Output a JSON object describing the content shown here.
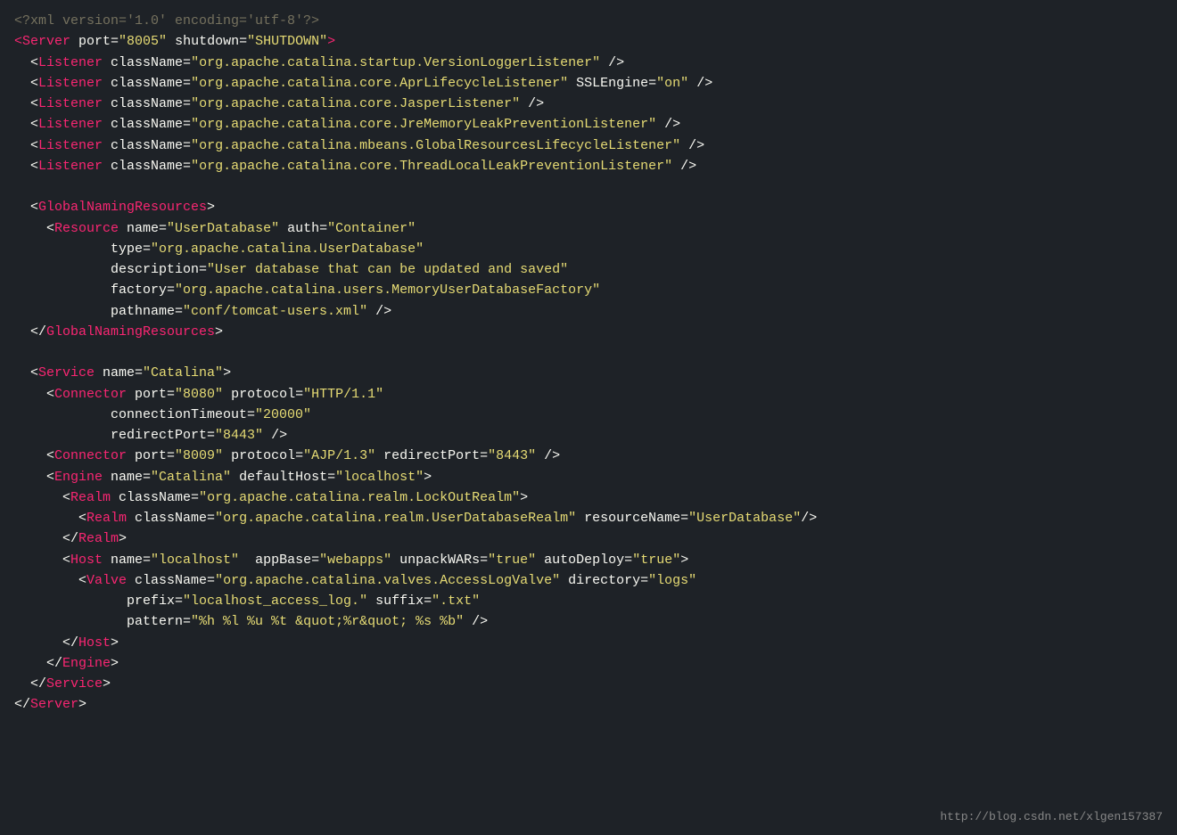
{
  "watermark": "http://blog.csdn.net/xlgen157387",
  "lines": [
    {
      "parts": [
        {
          "text": "<?xml version='1.0' encoding='utf-8'?>",
          "class": "prolog"
        }
      ]
    },
    {
      "parts": [
        {
          "text": "<",
          "class": "tag"
        },
        {
          "text": "Server",
          "class": "tag"
        },
        {
          "text": " port=",
          "class": "white"
        },
        {
          "text": "\"8005\"",
          "class": "attr-value"
        },
        {
          "text": " shutdown=",
          "class": "white"
        },
        {
          "text": "\"SHUTDOWN\"",
          "class": "attr-value"
        },
        {
          "text": ">",
          "class": "tag"
        }
      ]
    },
    {
      "parts": [
        {
          "text": "  <",
          "class": "white"
        },
        {
          "text": "Listener",
          "class": "tag"
        },
        {
          "text": " className=",
          "class": "white"
        },
        {
          "text": "\"org.apache.catalina.startup.VersionLoggerListener\"",
          "class": "attr-value"
        },
        {
          "text": " />",
          "class": "white"
        }
      ]
    },
    {
      "parts": [
        {
          "text": "  <",
          "class": "white"
        },
        {
          "text": "Listener",
          "class": "tag"
        },
        {
          "text": " className=",
          "class": "white"
        },
        {
          "text": "\"org.apache.catalina.core.AprLifecycleListener\"",
          "class": "attr-value"
        },
        {
          "text": " SSLEngine=",
          "class": "white"
        },
        {
          "text": "\"on\"",
          "class": "attr-value"
        },
        {
          "text": " />",
          "class": "white"
        }
      ]
    },
    {
      "parts": [
        {
          "text": "  <",
          "class": "white"
        },
        {
          "text": "Listener",
          "class": "tag"
        },
        {
          "text": " className=",
          "class": "white"
        },
        {
          "text": "\"org.apache.catalina.core.JasperListener\"",
          "class": "attr-value"
        },
        {
          "text": " />",
          "class": "white"
        }
      ]
    },
    {
      "parts": [
        {
          "text": "  <",
          "class": "white"
        },
        {
          "text": "Listener",
          "class": "tag"
        },
        {
          "text": " className=",
          "class": "white"
        },
        {
          "text": "\"org.apache.catalina.core.JreMemoryLeakPreventionListener\"",
          "class": "attr-value"
        },
        {
          "text": " />",
          "class": "white"
        }
      ]
    },
    {
      "parts": [
        {
          "text": "  <",
          "class": "white"
        },
        {
          "text": "Listener",
          "class": "tag"
        },
        {
          "text": " className=",
          "class": "white"
        },
        {
          "text": "\"org.apache.catalina.mbeans.GlobalResourcesLifecycleListener\"",
          "class": "attr-value"
        },
        {
          "text": " />",
          "class": "white"
        }
      ]
    },
    {
      "parts": [
        {
          "text": "  <",
          "class": "white"
        },
        {
          "text": "Listener",
          "class": "tag"
        },
        {
          "text": " className=",
          "class": "white"
        },
        {
          "text": "\"org.apache.catalina.core.ThreadLocalLeakPreventionListener\"",
          "class": "attr-value"
        },
        {
          "text": " />",
          "class": "white"
        }
      ]
    },
    {
      "parts": [
        {
          "text": "",
          "class": "white"
        }
      ]
    },
    {
      "parts": [
        {
          "text": "  <",
          "class": "white"
        },
        {
          "text": "GlobalNamingResources",
          "class": "tag"
        },
        {
          "text": ">",
          "class": "white"
        }
      ]
    },
    {
      "parts": [
        {
          "text": "    <",
          "class": "white"
        },
        {
          "text": "Resource",
          "class": "tag"
        },
        {
          "text": " name=",
          "class": "white"
        },
        {
          "text": "\"UserDatabase\"",
          "class": "attr-value"
        },
        {
          "text": " auth=",
          "class": "white"
        },
        {
          "text": "\"Container\"",
          "class": "attr-value"
        }
      ]
    },
    {
      "parts": [
        {
          "text": "            type=",
          "class": "white"
        },
        {
          "text": "\"org.apache.catalina.UserDatabase\"",
          "class": "attr-value"
        }
      ]
    },
    {
      "parts": [
        {
          "text": "            description=",
          "class": "white"
        },
        {
          "text": "\"User database that can be updated and saved\"",
          "class": "attr-value"
        }
      ]
    },
    {
      "parts": [
        {
          "text": "            factory=",
          "class": "white"
        },
        {
          "text": "\"org.apache.catalina.users.MemoryUserDatabaseFactory\"",
          "class": "attr-value"
        }
      ]
    },
    {
      "parts": [
        {
          "text": "            pathname=",
          "class": "white"
        },
        {
          "text": "\"conf/tomcat-users.xml\"",
          "class": "attr-value"
        },
        {
          "text": " />",
          "class": "white"
        }
      ]
    },
    {
      "parts": [
        {
          "text": "  </",
          "class": "white"
        },
        {
          "text": "GlobalNamingResources",
          "class": "tag"
        },
        {
          "text": ">",
          "class": "white"
        }
      ]
    },
    {
      "parts": [
        {
          "text": "",
          "class": "white"
        }
      ]
    },
    {
      "parts": [
        {
          "text": "  <",
          "class": "white"
        },
        {
          "text": "Service",
          "class": "tag"
        },
        {
          "text": " name=",
          "class": "white"
        },
        {
          "text": "\"Catalina\"",
          "class": "attr-value"
        },
        {
          "text": ">",
          "class": "white"
        }
      ]
    },
    {
      "parts": [
        {
          "text": "    <",
          "class": "white"
        },
        {
          "text": "Connector",
          "class": "tag"
        },
        {
          "text": " port=",
          "class": "white"
        },
        {
          "text": "\"8080\"",
          "class": "attr-value"
        },
        {
          "text": " protocol=",
          "class": "white"
        },
        {
          "text": "\"HTTP/1.1\"",
          "class": "attr-value"
        }
      ]
    },
    {
      "parts": [
        {
          "text": "            connectionTimeout=",
          "class": "white"
        },
        {
          "text": "\"20000\"",
          "class": "attr-value"
        }
      ]
    },
    {
      "parts": [
        {
          "text": "            redirectPort=",
          "class": "white"
        },
        {
          "text": "\"8443\"",
          "class": "attr-value"
        },
        {
          "text": " />",
          "class": "white"
        }
      ]
    },
    {
      "parts": [
        {
          "text": "    <",
          "class": "white"
        },
        {
          "text": "Connector",
          "class": "tag"
        },
        {
          "text": " port=",
          "class": "white"
        },
        {
          "text": "\"8009\"",
          "class": "attr-value"
        },
        {
          "text": " protocol=",
          "class": "white"
        },
        {
          "text": "\"AJP/1.3\"",
          "class": "attr-value"
        },
        {
          "text": " redirectPort=",
          "class": "white"
        },
        {
          "text": "\"8443\"",
          "class": "attr-value"
        },
        {
          "text": " />",
          "class": "white"
        }
      ]
    },
    {
      "parts": [
        {
          "text": "    <",
          "class": "white"
        },
        {
          "text": "Engine",
          "class": "tag"
        },
        {
          "text": " name=",
          "class": "white"
        },
        {
          "text": "\"Catalina\"",
          "class": "attr-value"
        },
        {
          "text": " defaultHost=",
          "class": "white"
        },
        {
          "text": "\"localhost\"",
          "class": "attr-value"
        },
        {
          "text": ">",
          "class": "white"
        }
      ]
    },
    {
      "parts": [
        {
          "text": "      <",
          "class": "white"
        },
        {
          "text": "Realm",
          "class": "tag"
        },
        {
          "text": " className=",
          "class": "white"
        },
        {
          "text": "\"org.apache.catalina.realm.LockOutRealm\"",
          "class": "attr-value"
        },
        {
          "text": ">",
          "class": "white"
        }
      ]
    },
    {
      "parts": [
        {
          "text": "        <",
          "class": "white"
        },
        {
          "text": "Realm",
          "class": "tag"
        },
        {
          "text": " className=",
          "class": "white"
        },
        {
          "text": "\"org.apache.catalina.realm.UserDatabaseRealm\"",
          "class": "attr-value"
        },
        {
          "text": " resourceName=",
          "class": "white"
        },
        {
          "text": "\"UserDatabase\"",
          "class": "attr-value"
        },
        {
          "text": "/>",
          "class": "white"
        }
      ]
    },
    {
      "parts": [
        {
          "text": "      </",
          "class": "white"
        },
        {
          "text": "Realm",
          "class": "tag"
        },
        {
          "text": ">",
          "class": "white"
        }
      ]
    },
    {
      "parts": [
        {
          "text": "      <",
          "class": "white"
        },
        {
          "text": "Host",
          "class": "tag"
        },
        {
          "text": " name=",
          "class": "white"
        },
        {
          "text": "\"localhost\"",
          "class": "attr-value"
        },
        {
          "text": "  appBase=",
          "class": "white"
        },
        {
          "text": "\"webapps\"",
          "class": "attr-value"
        },
        {
          "text": " unpackWARs=",
          "class": "white"
        },
        {
          "text": "\"true\"",
          "class": "attr-value"
        },
        {
          "text": " autoDeploy=",
          "class": "white"
        },
        {
          "text": "\"true\"",
          "class": "attr-value"
        },
        {
          "text": ">",
          "class": "white"
        }
      ]
    },
    {
      "parts": [
        {
          "text": "        <",
          "class": "white"
        },
        {
          "text": "Valve",
          "class": "tag"
        },
        {
          "text": " className=",
          "class": "white"
        },
        {
          "text": "\"org.apache.catalina.valves.AccessLogValve\"",
          "class": "attr-value"
        },
        {
          "text": " directory=",
          "class": "white"
        },
        {
          "text": "\"logs\"",
          "class": "attr-value"
        }
      ]
    },
    {
      "parts": [
        {
          "text": "              prefix=",
          "class": "white"
        },
        {
          "text": "\"localhost_access_log.\"",
          "class": "attr-value"
        },
        {
          "text": " suffix=",
          "class": "white"
        },
        {
          "text": "\".txt\"",
          "class": "attr-value"
        }
      ]
    },
    {
      "parts": [
        {
          "text": "              pattern=",
          "class": "white"
        },
        {
          "text": "\"%h %l %u %t &quot;%r&quot; %s %b\"",
          "class": "attr-value"
        },
        {
          "text": " />",
          "class": "white"
        }
      ]
    },
    {
      "parts": [
        {
          "text": "      </",
          "class": "white"
        },
        {
          "text": "Host",
          "class": "tag"
        },
        {
          "text": ">",
          "class": "white"
        }
      ]
    },
    {
      "parts": [
        {
          "text": "    </",
          "class": "white"
        },
        {
          "text": "Engine",
          "class": "tag"
        },
        {
          "text": ">",
          "class": "white"
        }
      ]
    },
    {
      "parts": [
        {
          "text": "  </",
          "class": "white"
        },
        {
          "text": "Service",
          "class": "tag"
        },
        {
          "text": ">",
          "class": "white"
        }
      ]
    },
    {
      "parts": [
        {
          "text": "</",
          "class": "white"
        },
        {
          "text": "Server",
          "class": "tag"
        },
        {
          "text": ">",
          "class": "white"
        }
      ]
    }
  ]
}
